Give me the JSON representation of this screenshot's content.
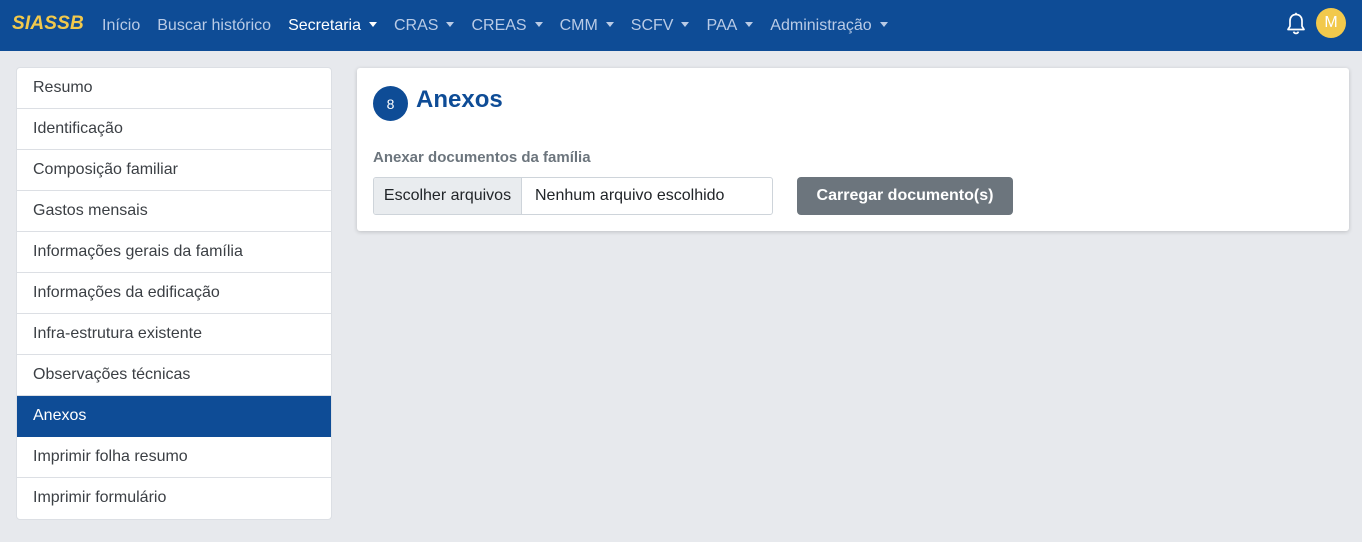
{
  "navbar": {
    "brand": "SIASSB",
    "items": [
      {
        "label": "Início",
        "dropdown": false,
        "active": false
      },
      {
        "label": "Buscar histórico",
        "dropdown": false,
        "active": false
      },
      {
        "label": "Secretaria",
        "dropdown": true,
        "active": true
      },
      {
        "label": "CRAS",
        "dropdown": true,
        "active": false
      },
      {
        "label": "CREAS",
        "dropdown": true,
        "active": false
      },
      {
        "label": "CMM",
        "dropdown": true,
        "active": false
      },
      {
        "label": "SCFV",
        "dropdown": true,
        "active": false
      },
      {
        "label": "PAA",
        "dropdown": true,
        "active": false
      },
      {
        "label": "Administração",
        "dropdown": true,
        "active": false
      }
    ],
    "notification_icon": "bell-icon",
    "avatar_initial": "M"
  },
  "sidebar": {
    "items": [
      {
        "label": "Resumo",
        "active": false
      },
      {
        "label": "Identificação",
        "active": false
      },
      {
        "label": "Composição familiar",
        "active": false
      },
      {
        "label": "Gastos mensais",
        "active": false
      },
      {
        "label": "Informações gerais da família",
        "active": false
      },
      {
        "label": "Informações da edificação",
        "active": false
      },
      {
        "label": "Infra-estrutura existente",
        "active": false
      },
      {
        "label": "Observações técnicas",
        "active": false
      },
      {
        "label": "Anexos",
        "active": true
      },
      {
        "label": "Imprimir folha resumo",
        "active": false
      },
      {
        "label": "Imprimir formulário",
        "active": false
      }
    ]
  },
  "main": {
    "step_number": "8",
    "title": "Anexos",
    "field_label": "Anexar documentos da família",
    "file_button": "Escolher arquivos",
    "file_status": "Nenhum arquivo escolhido",
    "upload_button": "Carregar documento(s)"
  },
  "colors": {
    "primary": "#0e4c96",
    "brand": "#f2c94c",
    "secondary_button": "#6c757d",
    "background": "#e7e9ed"
  }
}
